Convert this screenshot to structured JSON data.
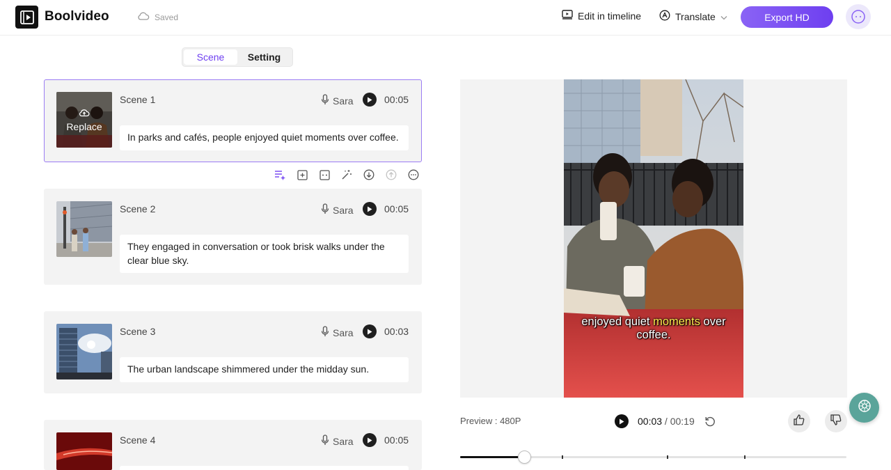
{
  "app": {
    "name": "Boolvideo",
    "save_status": "Saved"
  },
  "header": {
    "edit_timeline_label": "Edit in timeline",
    "translate_label": "Translate",
    "export_label": "Export HD"
  },
  "tabs": [
    {
      "label": "Scene",
      "active": true
    },
    {
      "label": "Setting",
      "active": false
    }
  ],
  "scenes": [
    {
      "title": "Scene 1",
      "voice": "Sara",
      "duration": "00:05",
      "script": "In parks and cafés, people enjoyed quiet moments over coffee.",
      "replace_label": "Replace"
    },
    {
      "title": "Scene 2",
      "voice": "Sara",
      "duration": "00:05",
      "script": "They engaged in conversation or took brisk walks under the clear blue sky."
    },
    {
      "title": "Scene 3",
      "voice": "Sara",
      "duration": "00:03",
      "script": "The urban landscape shimmered under the midday sun."
    },
    {
      "title": "Scene 4",
      "voice": "Sara",
      "duration": "00:05",
      "script": ""
    }
  ],
  "preview": {
    "label": "Preview : 480P",
    "current_time": "00:03",
    "total_time": "00:19",
    "progress_fraction": 0.165,
    "markers": [
      0.263,
      0.536,
      0.736
    ],
    "caption": {
      "before": "enjoyed quiet ",
      "highlight": "moments",
      "after": " over coffee."
    }
  },
  "colors": {
    "accent": "#6e3ff0",
    "selected_border": "#9b7cf3",
    "caption_highlight": "#ffe84d",
    "help_fab": "#5aa49a"
  }
}
